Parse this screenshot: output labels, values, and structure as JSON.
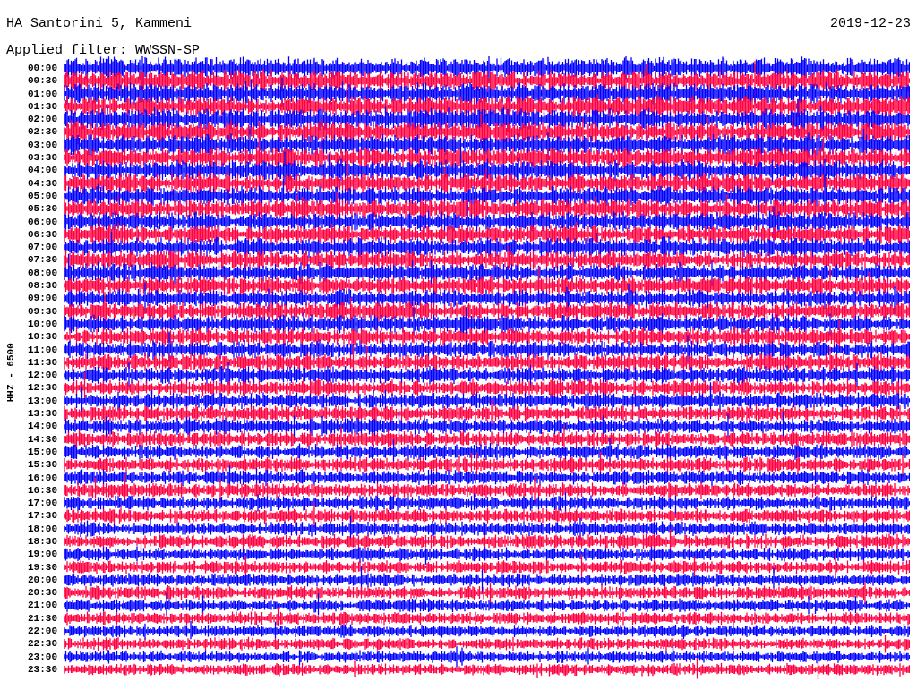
{
  "header": {
    "title": "HA Santorini 5, Kammeni",
    "date": "2019-12-23",
    "filter": "Applied filter: WWSSN-SP"
  },
  "axis_label": "HHZ - 6500",
  "time_labels": [
    "00:00",
    "00:30",
    "01:00",
    "01:30",
    "02:00",
    "02:30",
    "03:00",
    "03:30",
    "04:00",
    "04:30",
    "05:00",
    "05:30",
    "06:00",
    "06:30",
    "07:00",
    "07:30",
    "08:00",
    "08:30",
    "09:00",
    "09:30",
    "10:00",
    "10:30",
    "11:00",
    "11:30",
    "12:00",
    "12:30",
    "13:00",
    "13:30",
    "14:00",
    "14:30",
    "15:00",
    "15:30",
    "16:00",
    "16:30",
    "17:00",
    "17:30",
    "18:00",
    "18:30",
    "19:00",
    "19:30",
    "20:00",
    "20:30",
    "21:00",
    "21:30",
    "22:00",
    "22:30",
    "23:00",
    "23:30"
  ]
}
